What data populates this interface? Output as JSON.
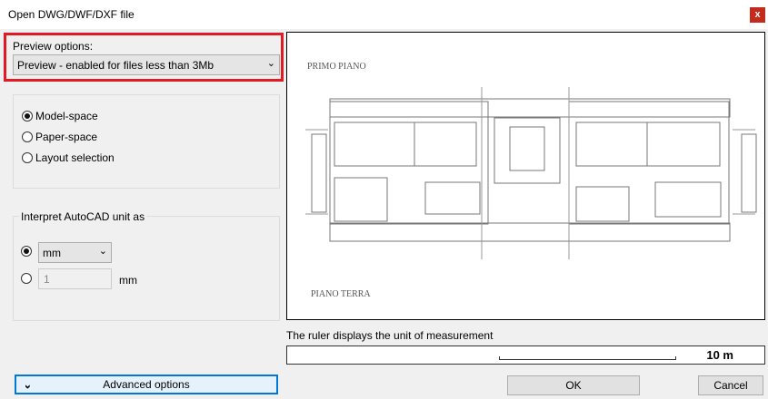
{
  "window": {
    "title": "Open DWG/DWF/DXF file",
    "close_glyph": "x"
  },
  "preview_options": {
    "label": "Preview options:",
    "selected": "Preview - enabled for files less than 3Mb"
  },
  "space": {
    "options": [
      {
        "label": "Model-space",
        "checked": true
      },
      {
        "label": "Paper-space",
        "checked": false
      },
      {
        "label": "Layout selection",
        "checked": false
      }
    ]
  },
  "unit": {
    "group_label": "Interpret AutoCAD unit as",
    "unit_selected": "mm",
    "custom_value": "1",
    "custom_unit": "mm",
    "use_dropdown": true
  },
  "preview_image": {
    "label_top": "PRIMO PIANO",
    "label_bottom": "PIANO TERRA"
  },
  "ruler": {
    "note": "The ruler displays the unit of measurement",
    "value": "10 m"
  },
  "buttons": {
    "advanced": "Advanced options",
    "ok": "OK",
    "cancel": "Cancel"
  }
}
